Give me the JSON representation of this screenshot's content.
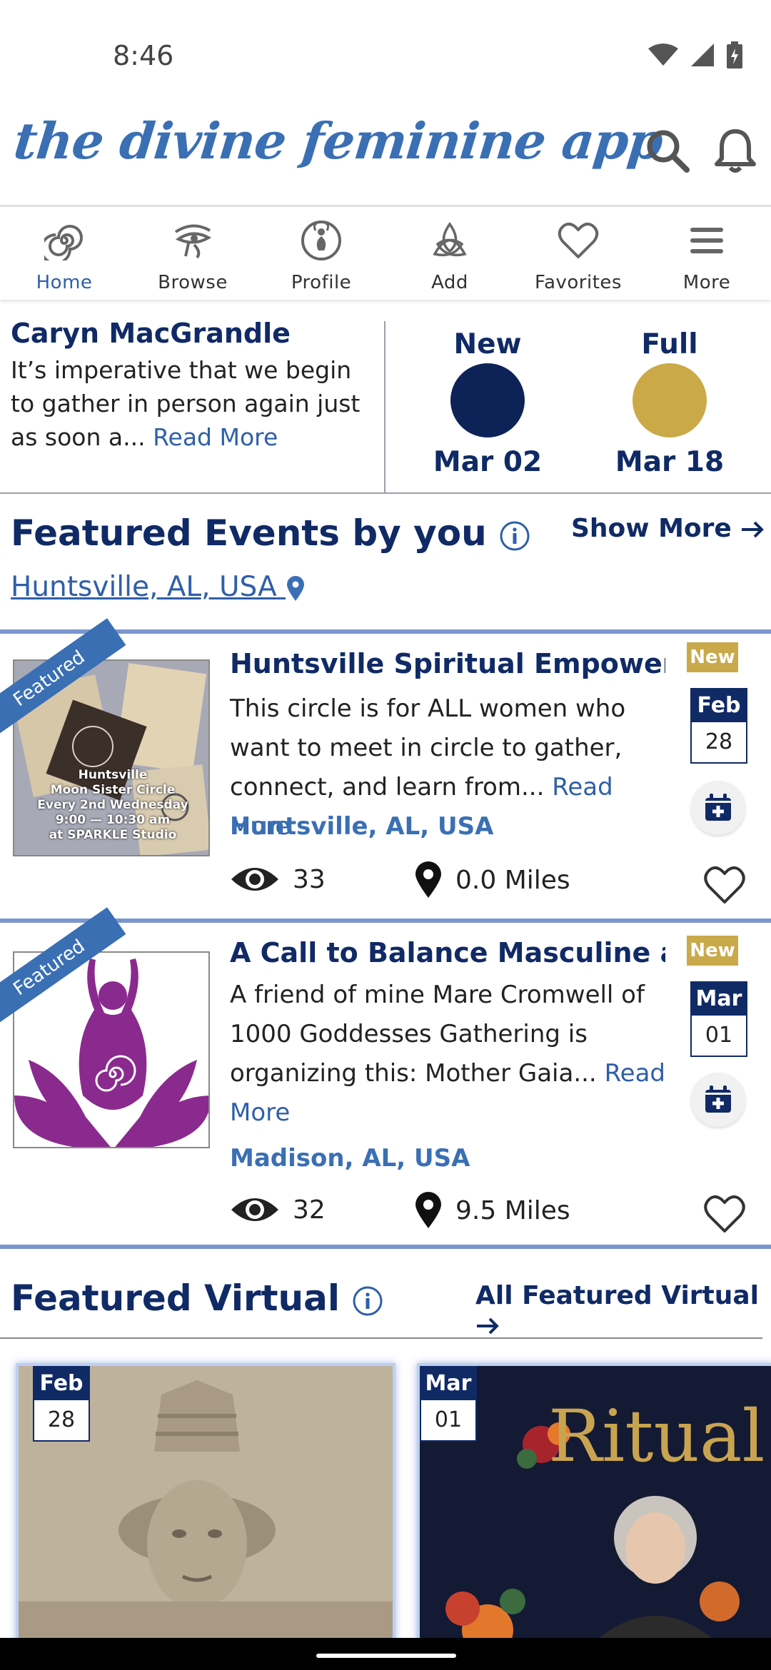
{
  "status_bar": {
    "time": "8:46"
  },
  "header": {
    "app_title": "the divine feminine app"
  },
  "nav": {
    "items": [
      {
        "label": "Home",
        "icon": "spiral-icon"
      },
      {
        "label": "Browse",
        "icon": "eye-of-horus-icon"
      },
      {
        "label": "Profile",
        "icon": "goddess-profile-icon"
      },
      {
        "label": "Add",
        "icon": "triquetra-icon"
      },
      {
        "label": "Favorites",
        "icon": "heart-icon"
      },
      {
        "label": "More",
        "icon": "menu-icon"
      }
    ],
    "active": "Home"
  },
  "quote": {
    "author": "Caryn MacGrandle",
    "text": "It’s imperative that we begin to gather in person again just as soon a...",
    "read_more": "Read More"
  },
  "moon": {
    "new": {
      "label": "New",
      "date": "Mar 02",
      "color": "#0d2257"
    },
    "full": {
      "label": "Full",
      "date": "Mar 18",
      "color": "#cba948"
    }
  },
  "featured_events": {
    "title": "Featured Events by you",
    "show_more": "Show More",
    "location": "Huntsville, AL, USA",
    "events": [
      {
        "ribbon": "Featured",
        "title": "Huntsville Spiritual Empowerme...",
        "description": "This circle is for ALL women who want to meet in circle to gather, connect, and learn from...",
        "read_more": "Read More",
        "location": "Huntsville, AL, USA",
        "views": "33",
        "distance": "0.0 Miles",
        "badge": "New",
        "month": "Feb",
        "day": "28",
        "thumb_text": [
          "Huntsville",
          "Moon Sister Circle",
          "Every 2nd Wednesday",
          "9:00 — 10:30 am",
          "at SPARKLE Studio"
        ]
      },
      {
        "ribbon": "Featured",
        "title": "A Call to Balance Masculine and ...",
        "description": "A friend of mine Mare Cromwell of 1000 Goddesses Gathering is organizing this: Mother Gaia...",
        "read_more": "Read More",
        "location": "Madison, AL, USA",
        "views": "32",
        "distance": "9.5 Miles",
        "badge": "New",
        "month": "Mar",
        "day": "01"
      }
    ]
  },
  "featured_virtual": {
    "title": "Featured Virtual",
    "all_link": "All Featured Virtual",
    "items": [
      {
        "month": "Feb",
        "day": "28"
      },
      {
        "month": "Mar",
        "day": "01",
        "image_text": "Ritual"
      }
    ]
  }
}
